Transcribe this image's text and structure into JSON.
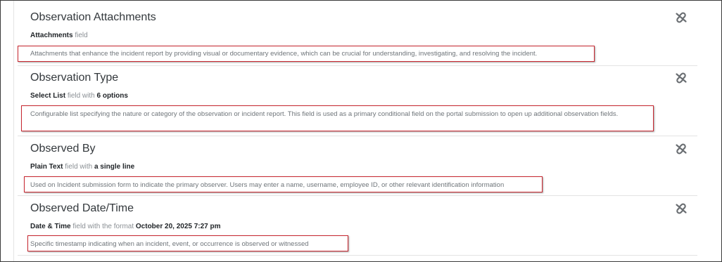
{
  "fields": [
    {
      "title": "Observation Attachments",
      "type_label": "Attachments",
      "field_word": "field",
      "with_word": "",
      "detail": "",
      "description": "Attachments that enhance the incident report by providing visual or documentary evidence, which can be crucial for understanding, investigating, and resolving the incident.",
      "icon": "unlink-icon"
    },
    {
      "title": "Observation Type",
      "type_label": "Select List",
      "field_word": "field with",
      "with_word": "",
      "detail": "6 options",
      "description": "Configurable list specifying the nature or category of the observation or incident report. This field is used as a primary conditional field on the portal submission to open up additional observation fields.",
      "icon": "unlink-icon"
    },
    {
      "title": "Observed By",
      "type_label": "Plain Text",
      "field_word": "field with",
      "with_word": "",
      "detail": "a single line",
      "description": "Used on Incident submission form to indicate the primary observer. Users may enter a name, username, employee ID, or other relevant identification information",
      "icon": "unlink-icon"
    },
    {
      "title": "Observed Date/Time",
      "type_label": "Date & Time",
      "field_word": "field with the format",
      "with_word": "",
      "detail": "October 20, 2025 7:27 pm",
      "description": "Specific timestamp indicating when an incident, event, or occurrence is observed or witnessed",
      "icon": "unlink-icon"
    }
  ],
  "colors": {
    "highlight_border": "#c8262f",
    "icon": "#6b6f73"
  }
}
